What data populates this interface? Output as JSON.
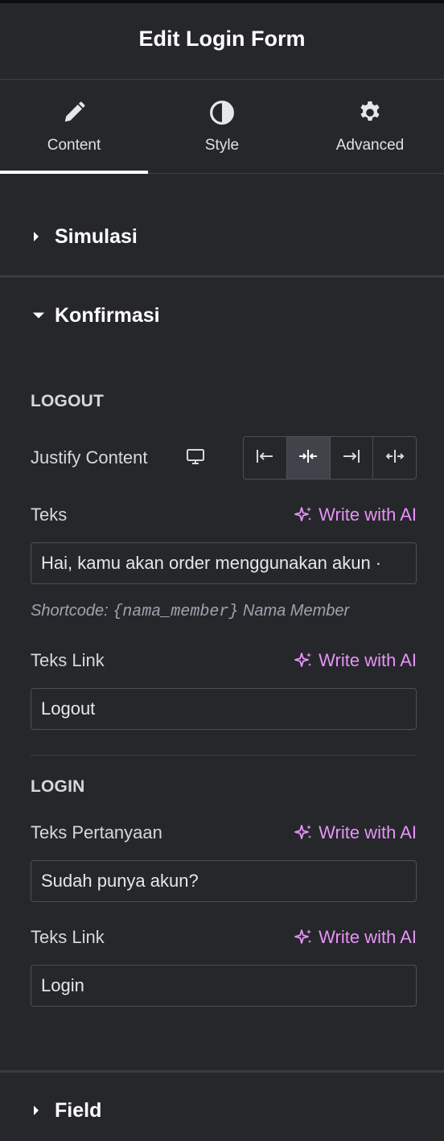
{
  "panel": {
    "title": "Edit Login Form"
  },
  "tabs": [
    {
      "label": "Content",
      "icon": "pencil-icon",
      "active": true
    },
    {
      "label": "Style",
      "icon": "contrast-icon",
      "active": false
    },
    {
      "label": "Advanced",
      "icon": "gear-icon",
      "active": false
    }
  ],
  "sections": {
    "simulasi": {
      "title": "Simulasi",
      "expanded": false
    },
    "konfirmasi": {
      "title": "Konfirmasi",
      "expanded": true
    },
    "field": {
      "title": "Field",
      "expanded": false
    }
  },
  "logout": {
    "heading": "LOGOUT",
    "justify_label": "Justify Content",
    "justify_selected": "center",
    "teks_label": "Teks",
    "teks_value": "Hai, kamu akan order menggunakan akun ·",
    "help_prefix": "Shortcode: ",
    "help_code": "{nama_member}",
    "help_suffix": " Nama Member",
    "link_label": "Teks Link",
    "link_value": "Logout"
  },
  "login": {
    "heading": "LOGIN",
    "question_label": "Teks Pertanyaan",
    "question_value": "Sudah punya akun?",
    "link_label": "Teks Link",
    "link_value": "Login"
  },
  "ai_button_label": "Write with AI",
  "colors": {
    "accent_ai": "#e793f8",
    "background": "#26272b",
    "border": "#4d4f55"
  }
}
